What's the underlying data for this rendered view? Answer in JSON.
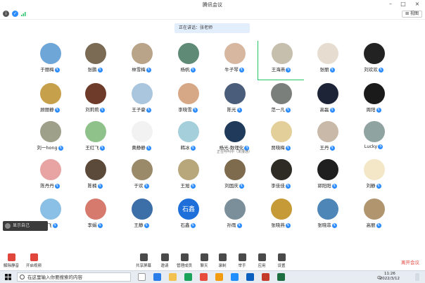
{
  "window": {
    "title": "腾讯会议"
  },
  "toolbar": {
    "view_label": "⊞ 视图"
  },
  "banner": {
    "text": "正在讲话：张老师"
  },
  "participants": [
    {
      "name": "于丽梅",
      "color": "#6ea6d8",
      "row": 0,
      "col": 0
    },
    {
      "name": "张鹏",
      "color": "#7b6a54",
      "row": 0,
      "col": 1
    },
    {
      "name": "林雪梅",
      "color": "#b9a48a",
      "row": 0,
      "col": 2
    },
    {
      "name": "杨帆",
      "color": "#5f8a75",
      "row": 0,
      "col": 3
    },
    {
      "name": "牛子琴",
      "color": "#d8b7a1",
      "row": 0,
      "col": 4
    },
    {
      "name": "王海燕",
      "color": "#c7bfae",
      "row": 0,
      "col": 5,
      "active": true
    },
    {
      "name": "张丽",
      "color": "#e6ddd0",
      "row": 0,
      "col": 6
    },
    {
      "name": "刘欢欢",
      "color": "#222222",
      "row": 0,
      "col": 7
    },
    {
      "name": "顾丽静",
      "color": "#c6a04a",
      "row": 1,
      "col": 0
    },
    {
      "name": "刘莉莉",
      "color": "#6e3a2a",
      "row": 1,
      "col": 1
    },
    {
      "name": "王子豪",
      "color": "#a9c6de",
      "row": 1,
      "col": 2
    },
    {
      "name": "李晓雪",
      "color": "#d7a886",
      "row": 1,
      "col": 3
    },
    {
      "name": "陈光",
      "color": "#4a5d7a",
      "row": 1,
      "col": 4
    },
    {
      "name": "范一凡",
      "color": "#7a7f7c",
      "row": 1,
      "col": 5
    },
    {
      "name": "高磊",
      "color": "#1e2438",
      "row": 1,
      "col": 6
    },
    {
      "name": "周阳",
      "color": "#1a1a1a",
      "row": 1,
      "col": 7
    },
    {
      "name": "刘一hong",
      "color": "#9fa08a",
      "row": 2,
      "col": 0
    },
    {
      "name": "王红飞",
      "color": "#8fc28a",
      "row": 2,
      "col": 1
    },
    {
      "name": "黄静静",
      "color": "#f2f2f2",
      "row": 2,
      "col": 2
    },
    {
      "name": "韩冰",
      "color": "#a6cfdc",
      "row": 2,
      "col": 3
    },
    {
      "name": "杨光-数理化",
      "sub": "正在呼叫中（未接通）",
      "color": "#1f3a5a",
      "row": 2,
      "col": 4
    },
    {
      "name": "贾晓梅",
      "color": "#e3cf9a",
      "row": 2,
      "col": 5
    },
    {
      "name": "王丹",
      "color": "#c9b9a8",
      "row": 2,
      "col": 6
    },
    {
      "name": "Lucky",
      "color": "#8fa3a0",
      "row": 2,
      "col": 7
    },
    {
      "name": "陈丹丹",
      "color": "#e8a3a3",
      "row": 3,
      "col": 0
    },
    {
      "name": "陈楠",
      "color": "#5b4a3a",
      "row": 3,
      "col": 1
    },
    {
      "name": "于欢",
      "color": "#9a8a6a",
      "row": 3,
      "col": 2
    },
    {
      "name": "王旭",
      "color": "#b9a77c",
      "row": 3,
      "col": 3
    },
    {
      "name": "刘国庆",
      "color": "#7e6a4d",
      "row": 3,
      "col": 4
    },
    {
      "name": "李佳佳",
      "color": "#2e2a24",
      "row": 3,
      "col": 5
    },
    {
      "name": "郭阳阳",
      "color": "#1f1f1f",
      "row": 3,
      "col": 6
    },
    {
      "name": "刘静",
      "color": "#f4e7c7",
      "row": 3,
      "col": 7
    },
    {
      "name": "王飞",
      "color": "#8ac0e6",
      "row": 4,
      "col": 0
    },
    {
      "name": "李娟",
      "color": "#d67a6e",
      "row": 4,
      "col": 1
    },
    {
      "name": "王静",
      "color": "#3c6ea8",
      "row": 4,
      "col": 2
    },
    {
      "name": "石鑫",
      "color": "#1e6fd9",
      "text": "石鑫",
      "row": 4,
      "col": 3
    },
    {
      "name": "孙雨",
      "color": "#7b8f9a",
      "row": 4,
      "col": 4
    },
    {
      "name": "张晓燕",
      "color": "#c79a38",
      "row": 4,
      "col": 5
    },
    {
      "name": "张晓菲",
      "color": "#4f86b8",
      "row": 4,
      "col": 6
    },
    {
      "name": "高丽",
      "color": "#b0956f",
      "row": 4,
      "col": 7
    }
  ],
  "self_view": {
    "label": "显示自己"
  },
  "controls": [
    {
      "label": "解除静音",
      "icon": "microphone-icon",
      "red": true
    },
    {
      "label": "开启视频",
      "icon": "camera-icon",
      "red": true
    },
    {
      "label": "共享屏幕",
      "icon": "share-screen-icon"
    },
    {
      "label": "邀请",
      "icon": "invite-icon"
    },
    {
      "label": "管理成员",
      "icon": "participants-icon"
    },
    {
      "label": "聊天",
      "icon": "chat-icon"
    },
    {
      "label": "录制",
      "icon": "record-icon"
    },
    {
      "label": "举手",
      "icon": "hand-icon"
    },
    {
      "label": "应用",
      "icon": "apps-icon"
    },
    {
      "label": "设置",
      "icon": "settings-icon"
    }
  ],
  "end_button": "离开会议",
  "taskbar": {
    "search_placeholder": "在这里输入你要搜索的内容",
    "time": "11:26",
    "date": "2022/3/12",
    "tray_text": "中"
  }
}
